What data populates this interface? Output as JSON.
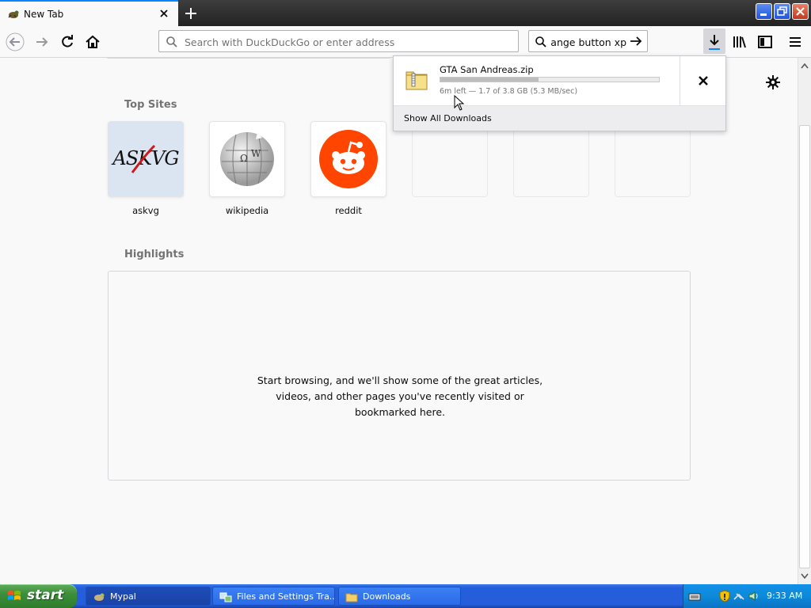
{
  "tab": {
    "title": "New Tab"
  },
  "navbar": {
    "url_placeholder": "Search with DuckDuckGo or enter address",
    "search_value": "hange button xp"
  },
  "newtab": {
    "topsites_title": "Top Sites",
    "sites": [
      {
        "label": "askvg",
        "logo_text": "ASKVG"
      },
      {
        "label": "wikipedia"
      },
      {
        "label": "reddit"
      }
    ],
    "highlights_title": "Highlights",
    "highlights_message": "Start browsing, and we'll show some of the great articles, videos, and other pages you've recently visited or bookmarked here."
  },
  "downloads": {
    "filename": "GTA San Andreas.zip",
    "status": "6m left — 1.7 of 3.8 GB (5.3 MB/sec)",
    "progress_fraction": 0.45,
    "show_all": "Show All Downloads"
  },
  "taskbar": {
    "start_label": "start",
    "tasks": [
      {
        "label": "Mypal"
      },
      {
        "label": "Files and Settings Tra..."
      },
      {
        "label": "Downloads"
      }
    ],
    "clock": "9:33 AM"
  },
  "colors": {
    "accent": "#0a84ff",
    "reddit": "#ff4500",
    "xp_blue": "#245edb",
    "xp_start_green": "#3c8f3a"
  }
}
